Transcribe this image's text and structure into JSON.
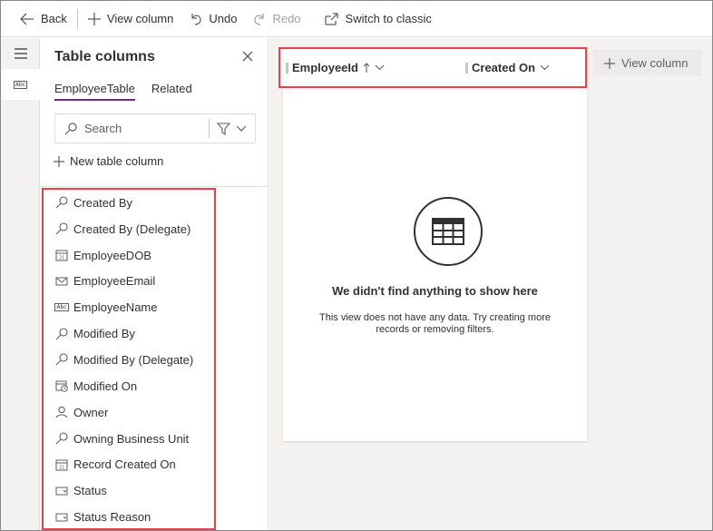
{
  "toolbar": {
    "back": "Back",
    "view_column": "View column",
    "undo": "Undo",
    "redo": "Redo",
    "switch_classic": "Switch to classic"
  },
  "panel": {
    "title": "Table columns",
    "tabs": [
      {
        "label": "EmployeeTable",
        "active": true
      },
      {
        "label": "Related",
        "active": false
      }
    ],
    "search_placeholder": "Search",
    "new_column": "New table column",
    "columns": [
      {
        "label": "Created By",
        "icon": "lookup-icon"
      },
      {
        "label": "Created By (Delegate)",
        "icon": "lookup-icon"
      },
      {
        "label": "EmployeeDOB",
        "icon": "calendar-icon"
      },
      {
        "label": "EmployeeEmail",
        "icon": "email-icon"
      },
      {
        "label": "EmployeeName",
        "icon": "text-icon"
      },
      {
        "label": "Modified By",
        "icon": "lookup-icon"
      },
      {
        "label": "Modified By (Delegate)",
        "icon": "lookup-icon"
      },
      {
        "label": "Modified On",
        "icon": "calendar-clock-icon"
      },
      {
        "label": "Owner",
        "icon": "person-icon"
      },
      {
        "label": "Owning Business Unit",
        "icon": "lookup-icon"
      },
      {
        "label": "Record Created On",
        "icon": "calendar-icon"
      },
      {
        "label": "Status",
        "icon": "option-set-icon"
      },
      {
        "label": "Status Reason",
        "icon": "option-set-icon"
      }
    ]
  },
  "grid": {
    "columns": [
      {
        "label": "EmployeeId",
        "sort": "ascending"
      },
      {
        "label": "Created On",
        "sort": "none"
      }
    ],
    "add_view_column": "View column",
    "empty_title": "We didn't find anything to show here",
    "empty_desc_line1": "This view does not have any data. Try creating more",
    "empty_desc_line2": "records or removing filters."
  },
  "colors": {
    "highlight_border": "#e8414c",
    "active_tab_underline": "#6b2d80"
  }
}
